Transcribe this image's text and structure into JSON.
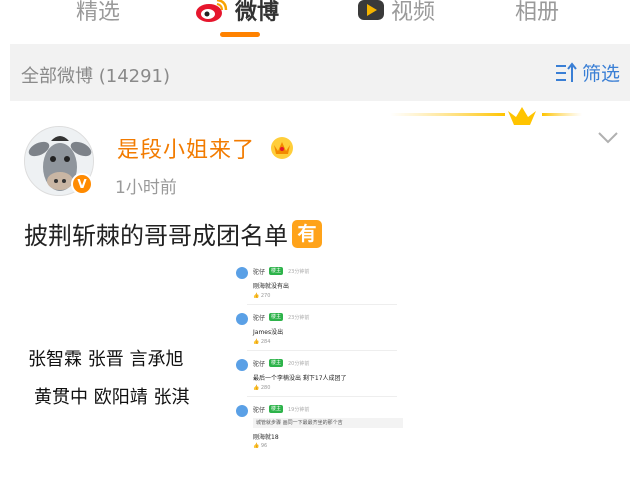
{
  "tabs": [
    {
      "label": "精选",
      "active": false
    },
    {
      "label": "微博",
      "active": true,
      "icon": "weibo-logo-icon"
    },
    {
      "label": "视频",
      "active": false,
      "icon": "video-play-icon"
    },
    {
      "label": "相册",
      "active": false
    }
  ],
  "filterbar": {
    "title": "全部微博 (14291)",
    "filter_label": "筛选",
    "filter_icon": "filter-sort-icon"
  },
  "post": {
    "username": "是段小姐来了",
    "timestamp": "1小时前",
    "text": "披荆斩棘的哥哥成团名单",
    "you_icon_label": "有",
    "image_left": {
      "line1": "张智霖 张晋 言承旭",
      "line2": "黄贯中 欧阳靖 张淇"
    },
    "image_right": {
      "comments": [
        {
          "name": "驼仔",
          "badge": "楼主",
          "meta": "23分钟前",
          "text": "刚海就没有出",
          "likes": "270",
          "reply": null
        },
        {
          "name": "驼仔",
          "badge": "楼主",
          "meta": "23分钟前",
          "text": "James没出",
          "likes": "284",
          "reply": null
        },
        {
          "name": "驼仔",
          "badge": "楼主",
          "meta": "20分钟前",
          "text": "最后一个李楠没出 剩下17人成团了",
          "likes": "280",
          "reply": null
        },
        {
          "name": "驼仔",
          "badge": "楼主",
          "meta": "19分钟前",
          "text": "刚海就18",
          "likes": "96",
          "reply": "城管就步骤 画同一下最最齐坐的那个吉"
        }
      ]
    }
  },
  "colors": {
    "accent": "#ff8200",
    "username": "#f27b00",
    "link": "#3a7fd5",
    "filterbar_bg": "#f2f2f2"
  }
}
